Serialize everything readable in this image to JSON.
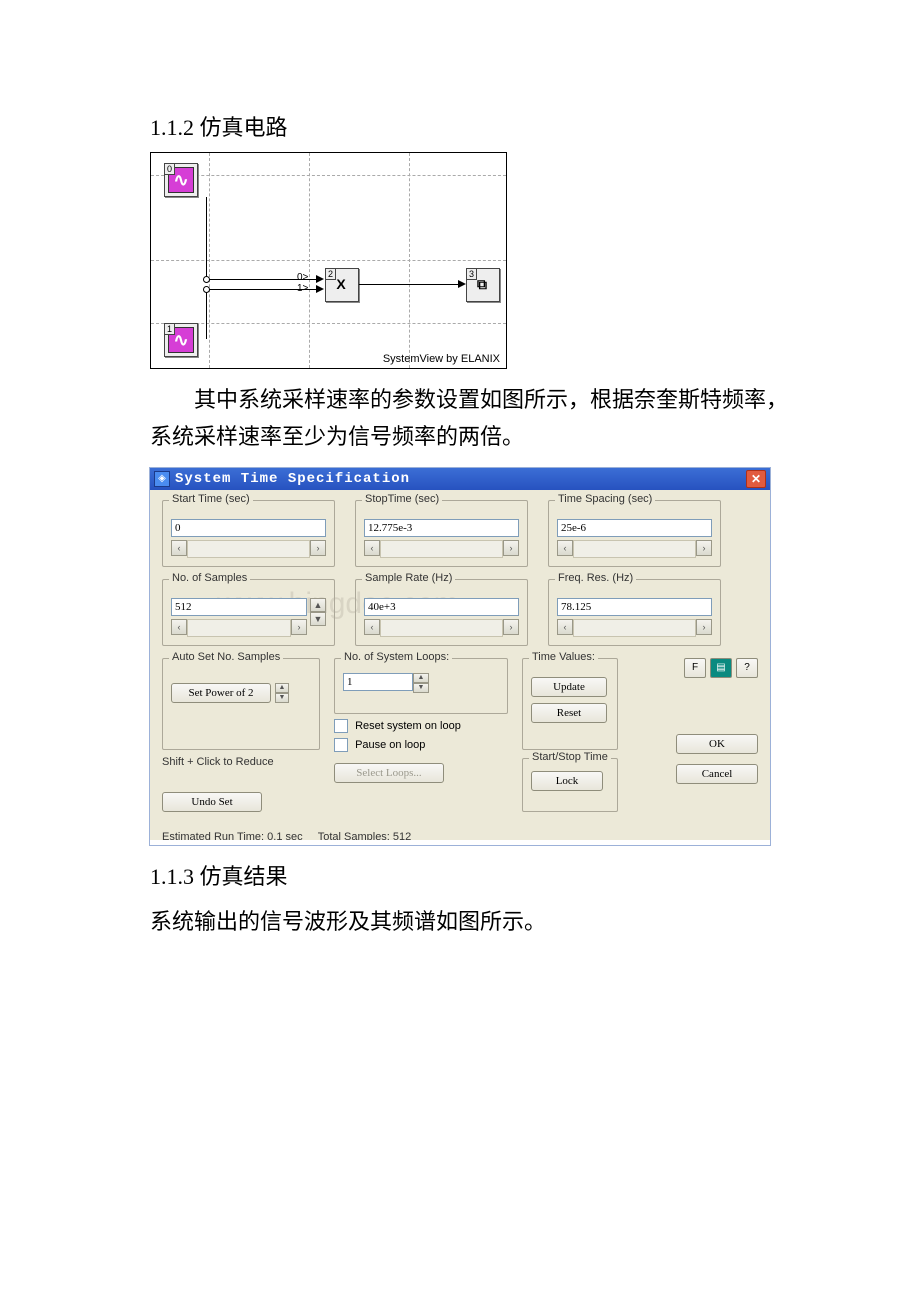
{
  "section1": {
    "heading": "1.1.2 仿真电路"
  },
  "circuit": {
    "block0_idx": "0",
    "block1_idx": "1",
    "block2_idx": "2",
    "block3_idx": "3",
    "mult_label": "X",
    "port0": "0>",
    "port1": "1>",
    "credit": "SystemView by ELANIX"
  },
  "para1": "其中系统采样速率的参数设置如图所示，根据奈奎斯特频率，系统采样速率至少为信号频率的两倍。",
  "dialog": {
    "title": "System Time Specification",
    "start_label": "Start Time (sec)",
    "start_value": "0",
    "stop_label": "StopTime (sec)",
    "stop_value": "12.775e-3",
    "spacing_label": "Time Spacing (sec)",
    "spacing_value": "25e-6",
    "samples_label": "No. of Samples",
    "samples_value": "512",
    "rate_label": "Sample Rate (Hz)",
    "rate_value": "40e+3",
    "freq_label": "Freq. Res. (Hz)",
    "freq_value": "78.125",
    "auto_label": "Auto Set No. Samples",
    "set_power": "Set Power of 2",
    "shift_hint": "Shift + Click to Reduce",
    "undo": "Undo Set",
    "loops_label": "No. of System Loops:",
    "loops_value": "1",
    "reset_cb": "Reset system on loop",
    "pause_cb": "Pause on loop",
    "select_loops": "Select Loops...",
    "timevals_label": "Time Values:",
    "update": "Update",
    "reset": "Reset",
    "startstop_label": "Start/Stop Time",
    "lock": "Lock",
    "ok": "OK",
    "cancel": "Cancel",
    "tool_f": "F",
    "tool_q": "?",
    "status_left": "Estimated Run Time: 0.1 sec",
    "status_right": "Total Samples: 512"
  },
  "section2": {
    "heading": "1.1.3 仿真结果",
    "para": "系统输出的信号波形及其频谱如图所示。"
  },
  "watermark": "www.bingdoc.com"
}
